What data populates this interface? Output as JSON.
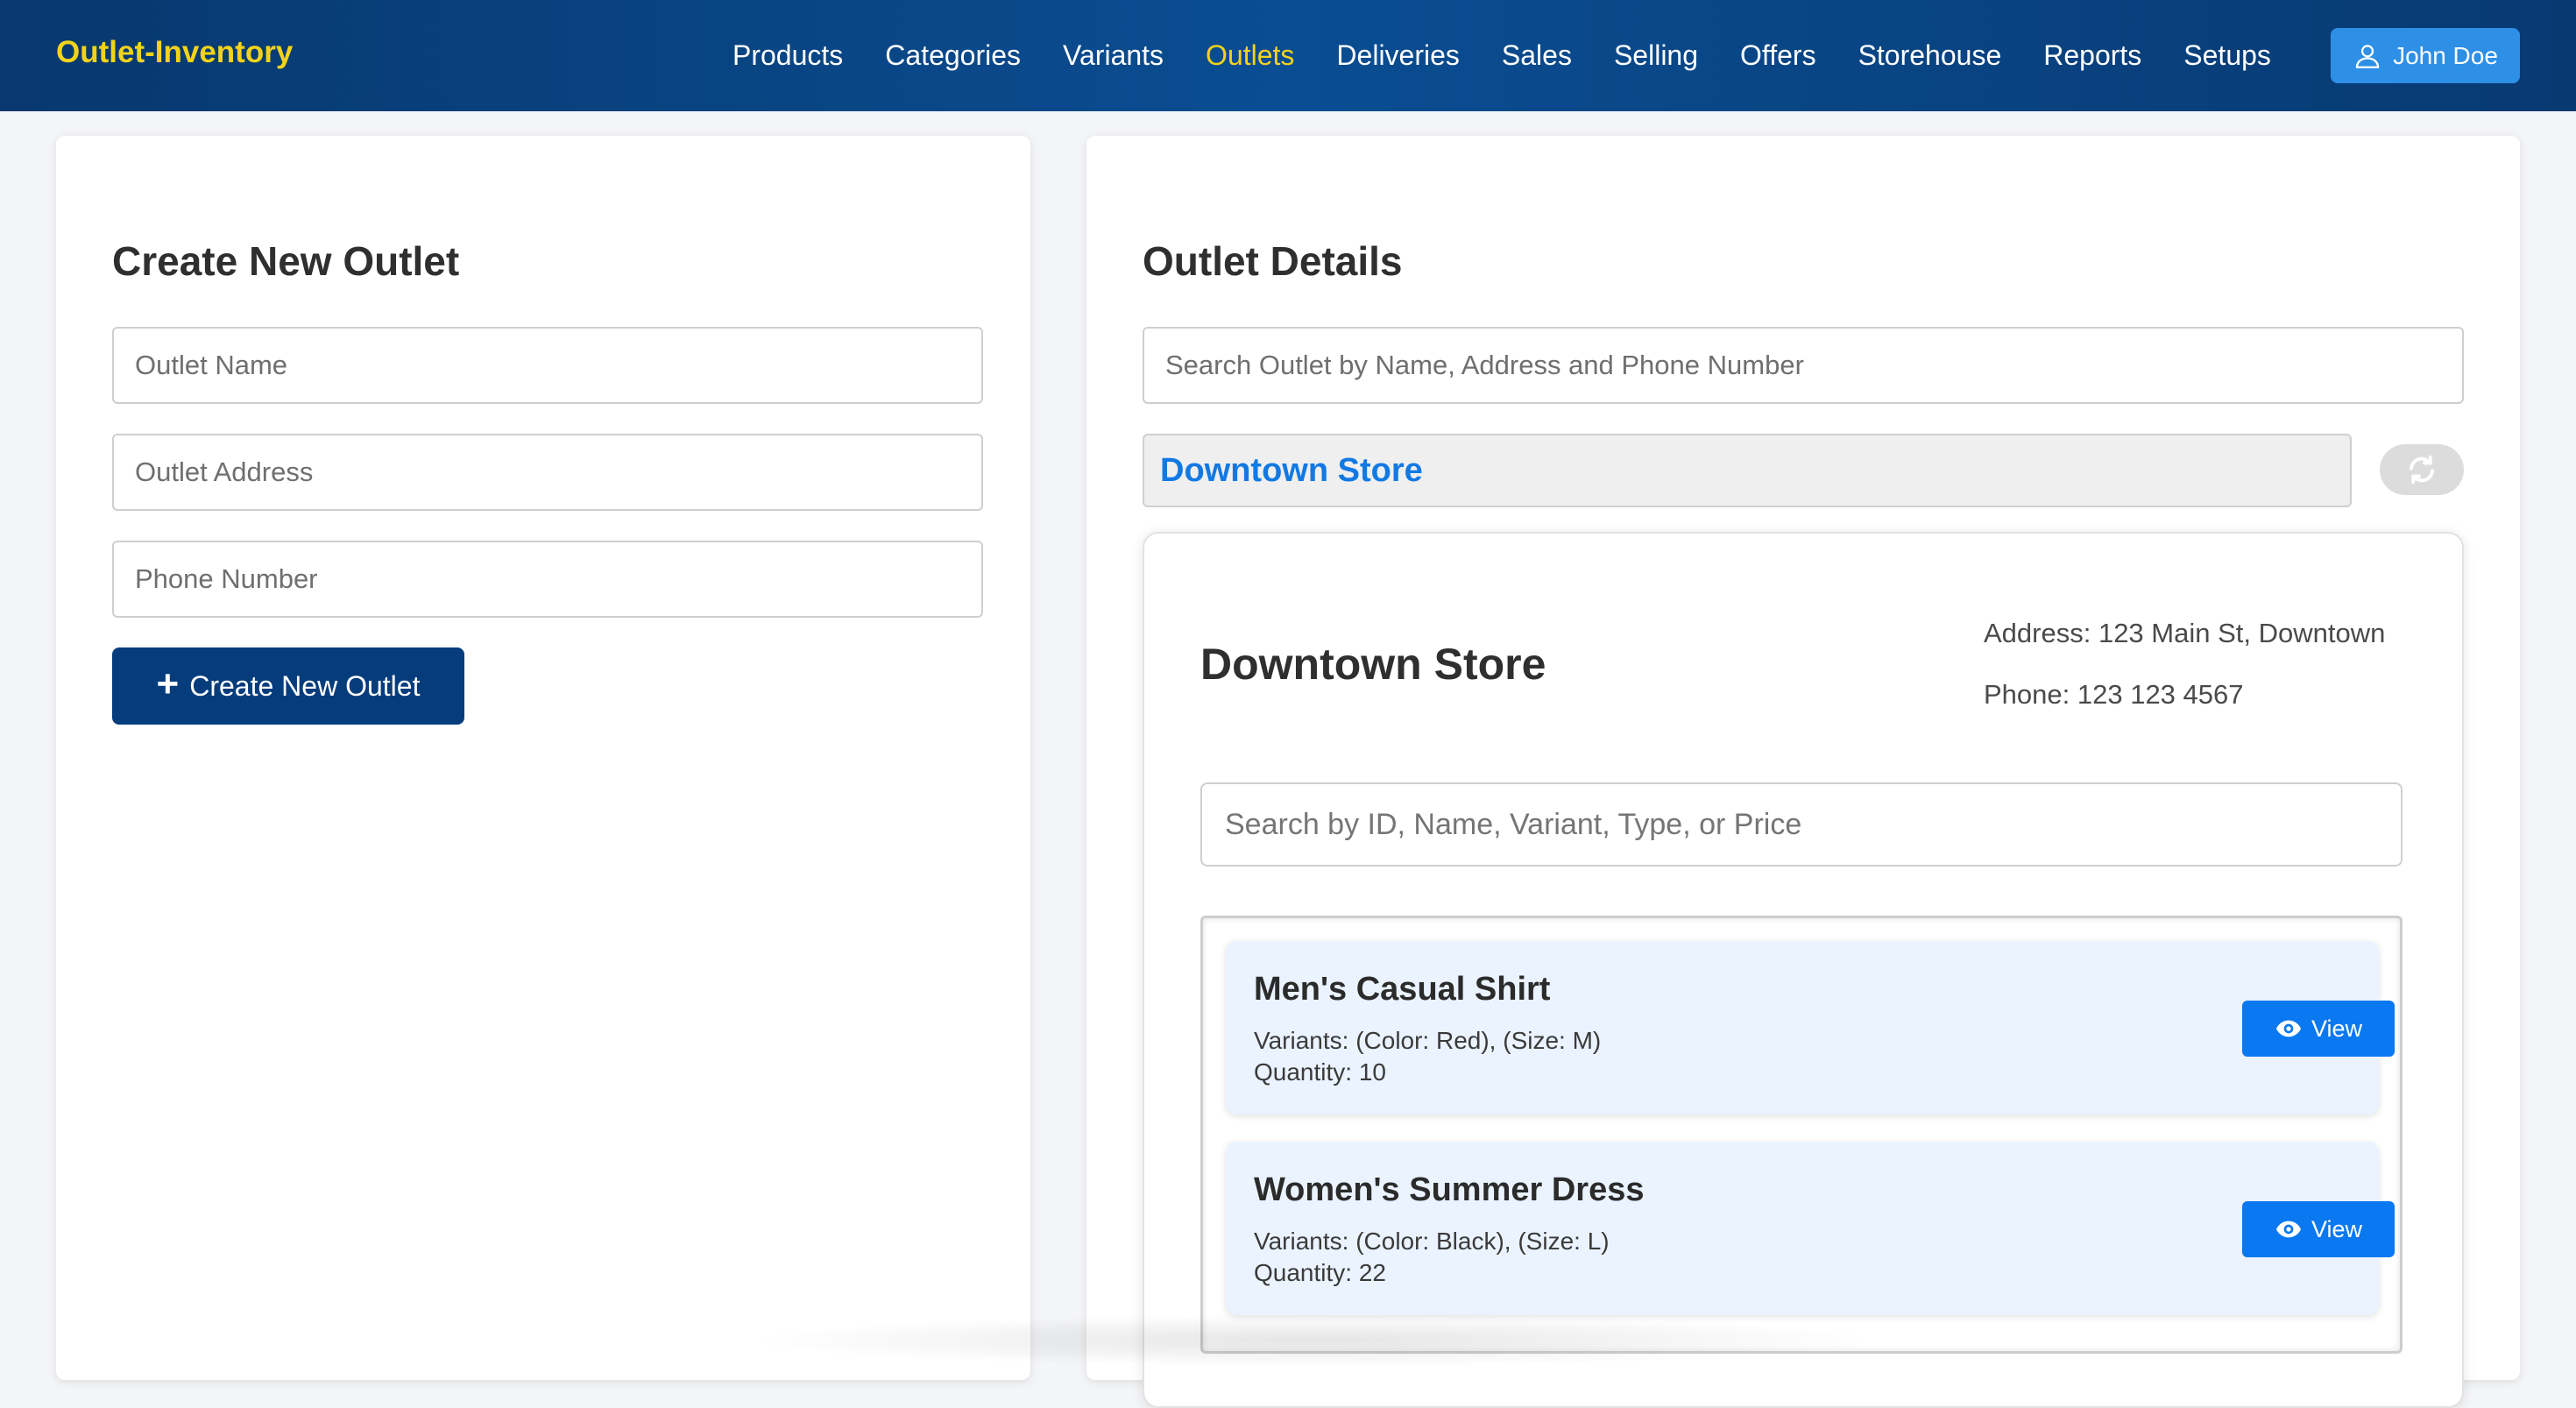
{
  "navbar": {
    "brand": "Outlet-Inventory",
    "links": [
      "Products",
      "Categories",
      "Variants",
      "Outlets",
      "Deliveries",
      "Sales",
      "Selling",
      "Offers",
      "Storehouse",
      "Reports",
      "Setups"
    ],
    "active_link": "Outlets",
    "user_name": "John Doe"
  },
  "create_outlet": {
    "title": "Create New Outlet",
    "name_placeholder": "Outlet Name",
    "address_placeholder": "Outlet Address",
    "phone_placeholder": "Phone Number",
    "submit_label": "Create New Outlet"
  },
  "outlet_details": {
    "title": "Outlet Details",
    "search_placeholder": "Search Outlet by Name, Address and Phone Number",
    "selected_outlet": "Downtown Store",
    "outlet": {
      "name": "Downtown Store",
      "address": "Address: 123 Main St, Downtown",
      "phone": "Phone: 123 123 4567"
    },
    "product_search_placeholder": "Search by ID, Name, Variant, Type, or Price",
    "products": [
      {
        "name": "Men's Casual Shirt",
        "variants": "Variants: (Color: Red), (Size: M)",
        "quantity": "Quantity: 10",
        "view_label": "View"
      },
      {
        "name": "Women's Summer Dress",
        "variants": "Variants: (Color: Black), (Size: L)",
        "quantity": "Quantity: 22",
        "view_label": "View"
      }
    ]
  },
  "colors": {
    "navbar": "#08386e",
    "brand": "#f2d31b",
    "primary_button": "#053c7c",
    "accent_blue": "#0a78f0",
    "product_card": "#eaf3ff"
  }
}
